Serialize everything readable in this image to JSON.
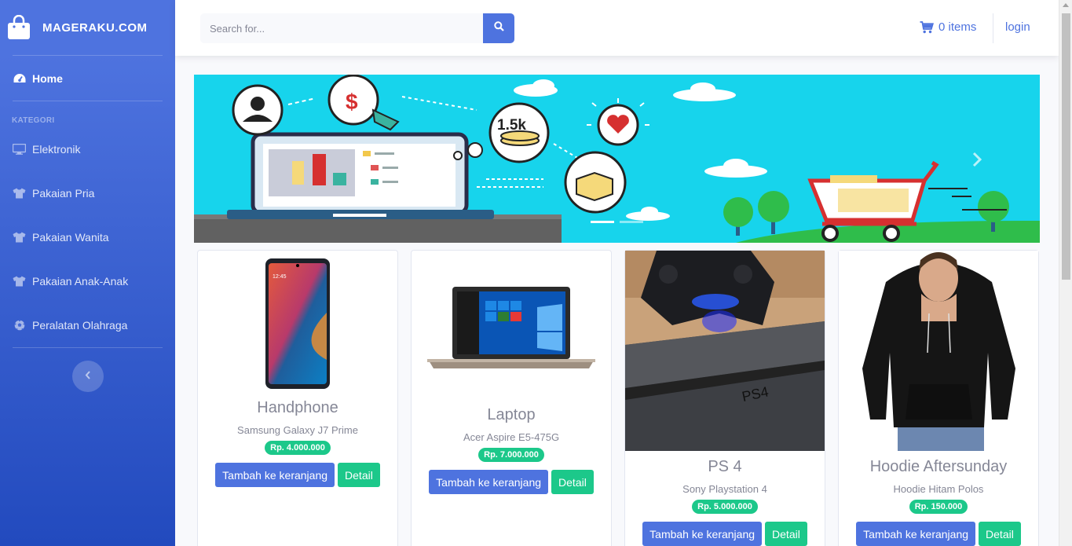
{
  "brand": {
    "name": "MAGERAKU.COM"
  },
  "sidebar": {
    "home_label": "Home",
    "heading": "KATEGORI",
    "items": [
      {
        "label": "Elektronik",
        "icon": "desktop-icon"
      },
      {
        "label": "Pakaian Pria",
        "icon": "tshirt-icon"
      },
      {
        "label": "Pakaian Wanita",
        "icon": "tshirt-icon"
      },
      {
        "label": "Pakaian Anak-Anak",
        "icon": "tshirt-icon"
      },
      {
        "label": "Peralatan Olahraga",
        "icon": "futbol-icon"
      }
    ]
  },
  "topbar": {
    "search_placeholder": "Search for...",
    "cart_label": "0 items",
    "login_label": "login"
  },
  "banner": {
    "slides": 2,
    "active_slide": 1,
    "promo_badge": "1.5k"
  },
  "products": [
    {
      "title": "Handphone",
      "name": "Samsung Galaxy J7 Prime",
      "price": "Rp. 4.000.000",
      "add_label": "Tambah ke keranjang",
      "detail_label": "Detail"
    },
    {
      "title": "Laptop",
      "name": "Acer Aspire E5-475G",
      "price": "Rp. 7.000.000",
      "add_label": "Tambah ke keranjang",
      "detail_label": "Detail"
    },
    {
      "title": "PS 4",
      "name": "Sony Playstation 4",
      "price": "Rp. 5.000.000",
      "add_label": "Tambah ke keranjang",
      "detail_label": "Detail"
    },
    {
      "title": "Hoodie Aftersunday",
      "name": "Hoodie Hitam Polos",
      "price": "Rp. 150.000",
      "add_label": "Tambah ke keranjang",
      "detail_label": "Detail"
    }
  ],
  "colors": {
    "primary": "#4e73df",
    "success": "#1cc88a",
    "banner": "#17d4ec"
  }
}
